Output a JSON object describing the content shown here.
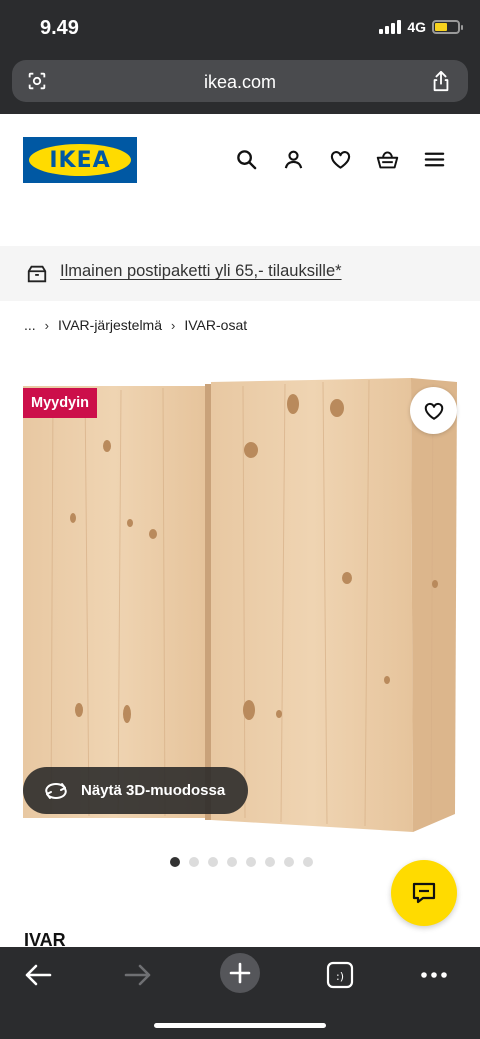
{
  "status": {
    "time": "9.49",
    "network": "4G"
  },
  "browser": {
    "url": "ikea.com"
  },
  "header": {
    "logo_text": "IKEA"
  },
  "promo": {
    "text": "Ilmainen postipaketti yli 65,- tilauksille*"
  },
  "breadcrumb": {
    "ellipsis": "...",
    "items": [
      "IVAR-järjestelmä",
      "IVAR-osat"
    ]
  },
  "gallery": {
    "badge": "Myydyin",
    "view3d_label": "Näytä 3D-muodossa",
    "dots_total": 8,
    "active_index": 0
  },
  "product": {
    "title": "IVAR"
  },
  "colors": {
    "ikea_blue": "#0058a3",
    "ikea_yellow": "#ffdb00",
    "badge_red": "#cc0f4a",
    "wood": "#e9c9a4"
  }
}
